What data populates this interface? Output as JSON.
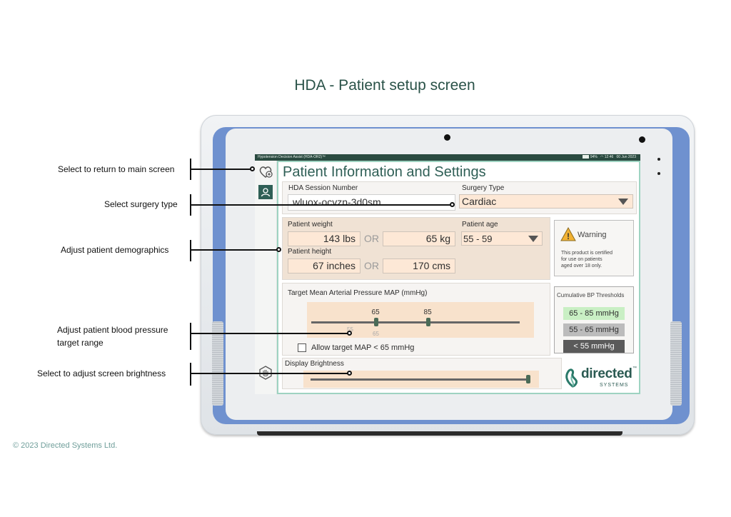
{
  "page_title": "HDA - Patient setup screen",
  "footer": "© 2023 Directed Systems Ltd.",
  "callouts": {
    "main_screen": "Select to return to main screen",
    "surgery": "Select surgery type",
    "demographics": "Adjust patient demographics",
    "bp_line1": "Adjust patient blood pressure",
    "bp_line2": "target range",
    "brightness": "Select to adjust screen brightness"
  },
  "statusbar": {
    "app": "Hypotension Decision Assist (HDA-OR2)™",
    "battery": "94%",
    "time": "12:46",
    "date": "00 Jun 2023"
  },
  "screen": {
    "title": "Patient Information and Settings",
    "session": {
      "label": "HDA Session Number",
      "value": "wluox-ocvzn-3d0sm"
    },
    "surgery": {
      "label": "Surgery Type",
      "value": "Cardiac"
    },
    "weight": {
      "label": "Patient weight",
      "lbs": "143 lbs",
      "kg": "65 kg",
      "or": "OR"
    },
    "height": {
      "label": "Patient height",
      "inches": "67 inches",
      "cms": "170 cms",
      "or": "OR"
    },
    "age": {
      "label": "Patient age",
      "value": "55 - 59"
    },
    "warning": {
      "title": "Warning",
      "text_line1": "This product is certified",
      "text_line2": "for use on patients",
      "text_line3": "aged over 18 only."
    },
    "map": {
      "label": "Target Mean Arterial Pressure MAP (mmHg)",
      "low": "65",
      "high": "85",
      "faint_upper": "55",
      "faint_lower": "65",
      "low_fraction": 0.31,
      "high_fraction": 0.56,
      "allow_label": "Allow target MAP < 65 mmHg",
      "allow_checked": false
    },
    "thresholds": {
      "title": "Cumulative BP Thresholds",
      "items": [
        {
          "label": "65 - 85 mmHg",
          "bg": "#c9efc4",
          "fg": "#2f2f2f"
        },
        {
          "label": "55 - 65 mmHg",
          "bg": "#bcbcbc",
          "fg": "#2f2f2f"
        },
        {
          "label": "< 55 mmHg",
          "bg": "#5a5a5a",
          "fg": "#ffffff"
        }
      ]
    },
    "brightness": {
      "label": "Display Brightness",
      "level": 0.99
    },
    "logo": {
      "name": "directed",
      "tm": "™",
      "sub": "SYSTEMS"
    }
  },
  "colors": {
    "accent": "#2f5f56",
    "field": "#fde8d6",
    "tablet_blue": "#6f91cf"
  }
}
